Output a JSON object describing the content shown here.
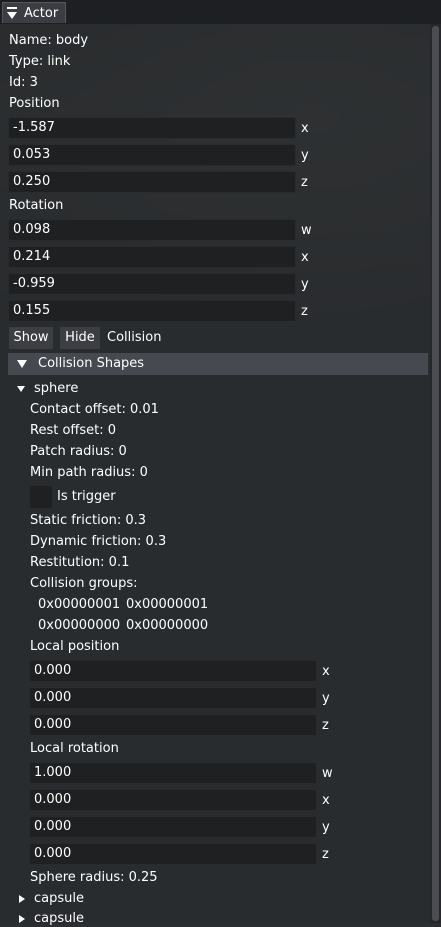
{
  "window": {
    "tab_label": "Actor"
  },
  "actor": {
    "name": "Name: body",
    "type": "Type: link",
    "id": "Id: 3",
    "position_label": "Position",
    "position": [
      {
        "value": "-1.587",
        "axis": "x"
      },
      {
        "value": "0.053",
        "axis": "y"
      },
      {
        "value": "0.250",
        "axis": "z"
      }
    ],
    "rotation_label": "Rotation",
    "rotation": [
      {
        "value": "0.098",
        "axis": "w"
      },
      {
        "value": "0.214",
        "axis": "x"
      },
      {
        "value": "-0.959",
        "axis": "y"
      },
      {
        "value": "0.155",
        "axis": "z"
      }
    ]
  },
  "collision_controls": {
    "show": "Show",
    "hide": "Hide",
    "label": "Collision"
  },
  "collision_shapes": {
    "header": "Collision Shapes",
    "sphere": {
      "title": "sphere",
      "contact_offset": "Contact offset: 0.01",
      "rest_offset": "Rest offset: 0",
      "patch_radius": "Patch radius: 0",
      "min_path_radius": "Min path radius: 0",
      "is_trigger_label": "Is trigger",
      "is_trigger": false,
      "static_friction": "Static friction: 0.3",
      "dynamic_friction": "Dynamic friction: 0.3",
      "restitution": "Restitution: 0.1",
      "collision_groups_label": "Collision groups:",
      "collision_groups": [
        [
          "0x00000001",
          "0x00000001"
        ],
        [
          "0x00000000",
          "0x00000000"
        ]
      ],
      "local_position_label": "Local position",
      "local_position": [
        {
          "value": "0.000",
          "axis": "x"
        },
        {
          "value": "0.000",
          "axis": "y"
        },
        {
          "value": "0.000",
          "axis": "z"
        }
      ],
      "local_rotation_label": "Local rotation",
      "local_rotation": [
        {
          "value": "1.000",
          "axis": "w"
        },
        {
          "value": "0.000",
          "axis": "x"
        },
        {
          "value": "0.000",
          "axis": "y"
        },
        {
          "value": "0.000",
          "axis": "z"
        }
      ],
      "sphere_radius": "Sphere radius: 0.25"
    },
    "others": [
      "capsule",
      "capsule"
    ]
  },
  "colors": {
    "panel_bg": "#2a2c2f",
    "field_bg": "#1f2022",
    "button_bg": "#3c3e43",
    "section_header_bg": "#464950",
    "text": "#ffffff"
  }
}
